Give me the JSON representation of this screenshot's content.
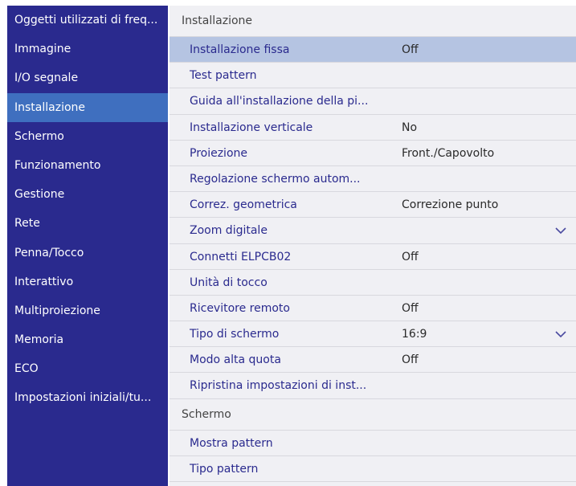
{
  "sidebar": {
    "items": [
      {
        "label": "Oggetti utilizzati di freq..."
      },
      {
        "label": "Immagine"
      },
      {
        "label": "I/O segnale"
      },
      {
        "label": "Installazione"
      },
      {
        "label": "Schermo"
      },
      {
        "label": "Funzionamento"
      },
      {
        "label": "Gestione"
      },
      {
        "label": "Rete"
      },
      {
        "label": "Penna/Tocco"
      },
      {
        "label": "Interattivo"
      },
      {
        "label": "Multiproiezione"
      },
      {
        "label": "Memoria"
      },
      {
        "label": "ECO"
      },
      {
        "label": "Impostazioni iniziali/tu..."
      }
    ],
    "active": "Installazione"
  },
  "main": {
    "sections": [
      {
        "header": "Installazione",
        "rows": [
          {
            "label": "Installazione fissa",
            "value": "Off"
          },
          {
            "label": "Test pattern",
            "value": ""
          },
          {
            "label": "Guida all'installazione della pi...",
            "value": ""
          },
          {
            "label": "Installazione verticale",
            "value": "No"
          },
          {
            "label": "Proiezione",
            "value": "Front./Capovolto"
          },
          {
            "label": "Regolazione schermo autom...",
            "value": ""
          },
          {
            "label": "Correz. geometrica",
            "value": "Correzione punto"
          },
          {
            "label": "Zoom digitale",
            "value": ""
          },
          {
            "label": "Connetti ELPCB02",
            "value": "Off"
          },
          {
            "label": "Unità di tocco",
            "value": ""
          },
          {
            "label": "Ricevitore remoto",
            "value": "Off"
          },
          {
            "label": "Tipo di schermo",
            "value": "16:9"
          },
          {
            "label": "Modo alta quota",
            "value": "Off"
          },
          {
            "label": "Ripristina impostazioni di inst...",
            "value": ""
          }
        ]
      },
      {
        "header": "Schermo",
        "rows": [
          {
            "label": "Mostra pattern",
            "value": ""
          },
          {
            "label": "Tipo pattern",
            "value": ""
          }
        ]
      }
    ]
  },
  "icons": {
    "dropdown": "chevron-down-icon"
  },
  "colors": {
    "sidebar_bg": "#2a2a8e",
    "sidebar_active": "#3f6fbf",
    "row_selected": "#b5c4e2",
    "text_accent": "#2a2a8e"
  }
}
